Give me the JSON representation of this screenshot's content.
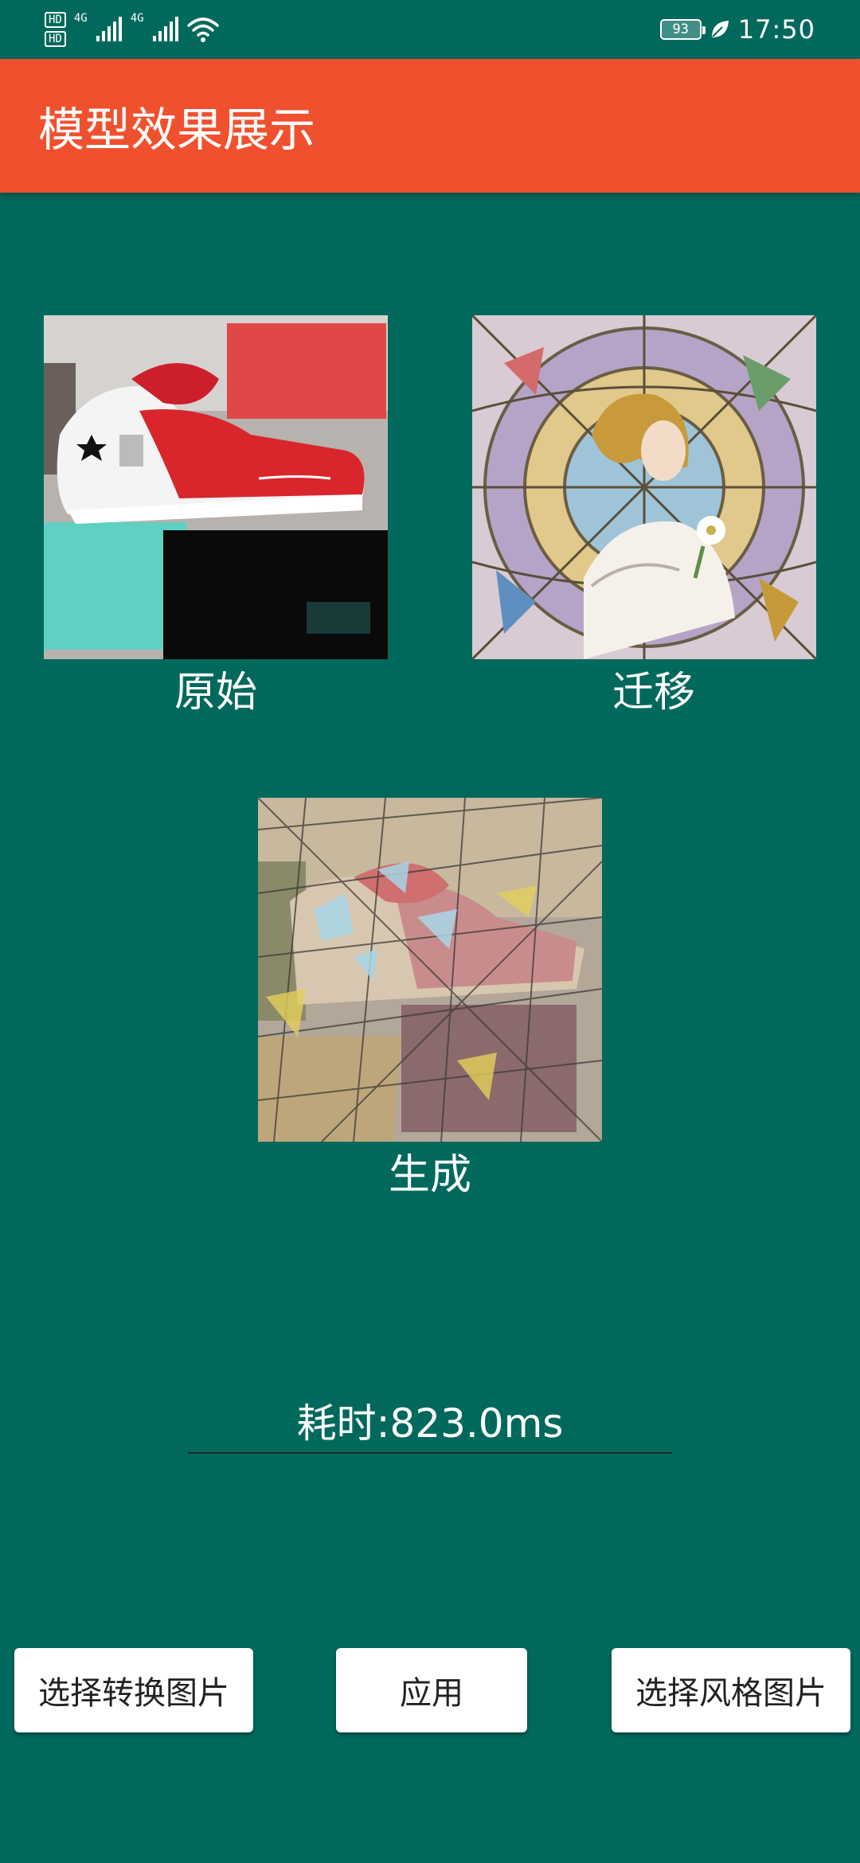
{
  "status_bar": {
    "hd_1": "HD",
    "hd_2": "HD",
    "net_1": "4G",
    "net_2": "4G",
    "battery": "93",
    "time": "17:50"
  },
  "app_bar": {
    "title": "模型效果展示"
  },
  "images": {
    "original_caption": "原始",
    "style_caption": "迁移",
    "result_caption": "生成"
  },
  "elapsed": {
    "text": "耗时:823.0ms"
  },
  "buttons": {
    "select_content": "选择转换图片",
    "apply": "应用",
    "select_style": "选择风格图片"
  },
  "colors": {
    "background": "#00695c",
    "app_bar": "#ef512e",
    "button": "#ffffff"
  }
}
